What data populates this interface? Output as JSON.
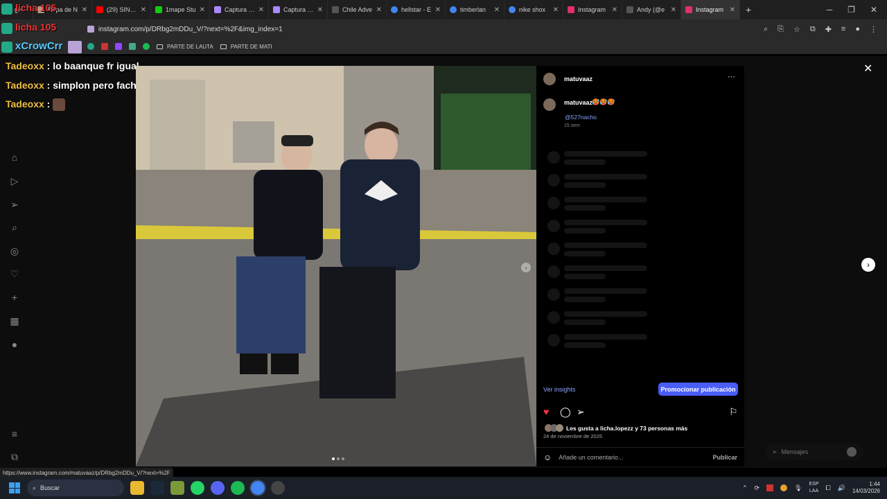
{
  "browser": {
    "tabs": [
      {
        "label": "ge",
        "favicon": "#2a8"
      },
      {
        "label": "Ropa de N",
        "favicon": "#a98"
      },
      {
        "label": "(29) SIN FI",
        "favicon": "#f00"
      },
      {
        "label": "1mape Stu",
        "favicon": "#1c1"
      },
      {
        "label": "Captura de",
        "favicon": "#aa88ff"
      },
      {
        "label": "Captura de",
        "favicon": "#aa88ff"
      },
      {
        "label": "Chile Adve",
        "favicon": "#111"
      },
      {
        "label": "hellstar - E",
        "favicon": "#4285f4"
      },
      {
        "label": "timberlan",
        "favicon": "#4285f4"
      },
      {
        "label": "nike shox",
        "favicon": "#4285f4"
      },
      {
        "label": "Instagram",
        "favicon": "#e1306c"
      },
      {
        "label": "Andy (@e",
        "favicon": "#111"
      },
      {
        "label": "Instagram",
        "favicon": "#e1306c"
      }
    ],
    "url": "instagram.com/p/DRbg2mDDu_V/?next=%2F&img_index=1",
    "bookmarks": [
      {
        "label": "PARTE DE LAUTA"
      },
      {
        "label": "PARTE DE MATI"
      }
    ],
    "status_url": "https://www.instagram.com/matuvaaz/p/DRbg2mDDu_V/?next=%2F"
  },
  "overlay": {
    "name1": "licha 105",
    "name2": "licha 105",
    "name3": "xCrowCrr"
  },
  "chat": [
    {
      "name": "Tadeoxx",
      "text": "lo baanque fr igual"
    },
    {
      "name": "Tadeoxx",
      "text": "simplon pero facheron eh"
    },
    {
      "name": "Tadeoxx",
      "text": ""
    }
  ],
  "post": {
    "username": "matuvaaz",
    "caption_user": "matuvaaz",
    "caption_emoji": "🥵🥵🥵",
    "mention": "@527nacho",
    "time": "15 sem",
    "insights": "Ver insights",
    "promote": "Promocionar publicación",
    "likes": "Les gusta a licha.lopezz y 73 personas más",
    "date": "24 de noviembre de 2025",
    "comment_placeholder": "Añade un comentario...",
    "publish": "Publicar",
    "more": "···"
  },
  "messages": {
    "label": "Mensajes"
  },
  "taskbar": {
    "search": "Buscar",
    "lang1": "ESP",
    "lang2": "LAA",
    "time": "1:44",
    "date": "14/03/2026"
  },
  "colors": {
    "accent": "#4a5df9",
    "like": "#ff3040",
    "link": "#8aa4ff"
  }
}
